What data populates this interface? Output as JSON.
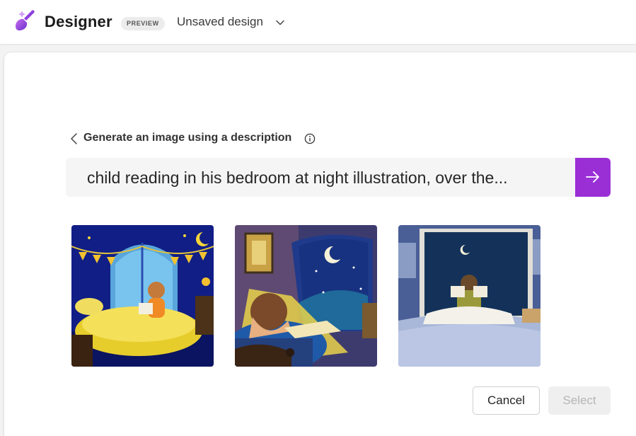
{
  "header": {
    "app_name": "Designer",
    "badge": "PREVIEW",
    "document_title": "Unsaved design"
  },
  "generator": {
    "back_label": "Generate an image using a description",
    "prompt_value": "child reading in his bedroom at night illustration, over the...",
    "submit_icon": "arrow-right-icon",
    "info_icon": "info-icon"
  },
  "results": [
    {
      "name": "generated-image-1",
      "scene": "child on bed by arched window, yellow blanket, bunting"
    },
    {
      "name": "generated-image-2",
      "scene": "boy reading by lamp, window with crescent moon"
    },
    {
      "name": "generated-image-3",
      "scene": "child reading in bed facing night window"
    }
  ],
  "actions": {
    "cancel_label": "Cancel",
    "select_label": "Select"
  },
  "colors": {
    "accent": "#9a2fd6",
    "header_bg": "#ffffff",
    "page_bg": "#f3f3f3"
  }
}
